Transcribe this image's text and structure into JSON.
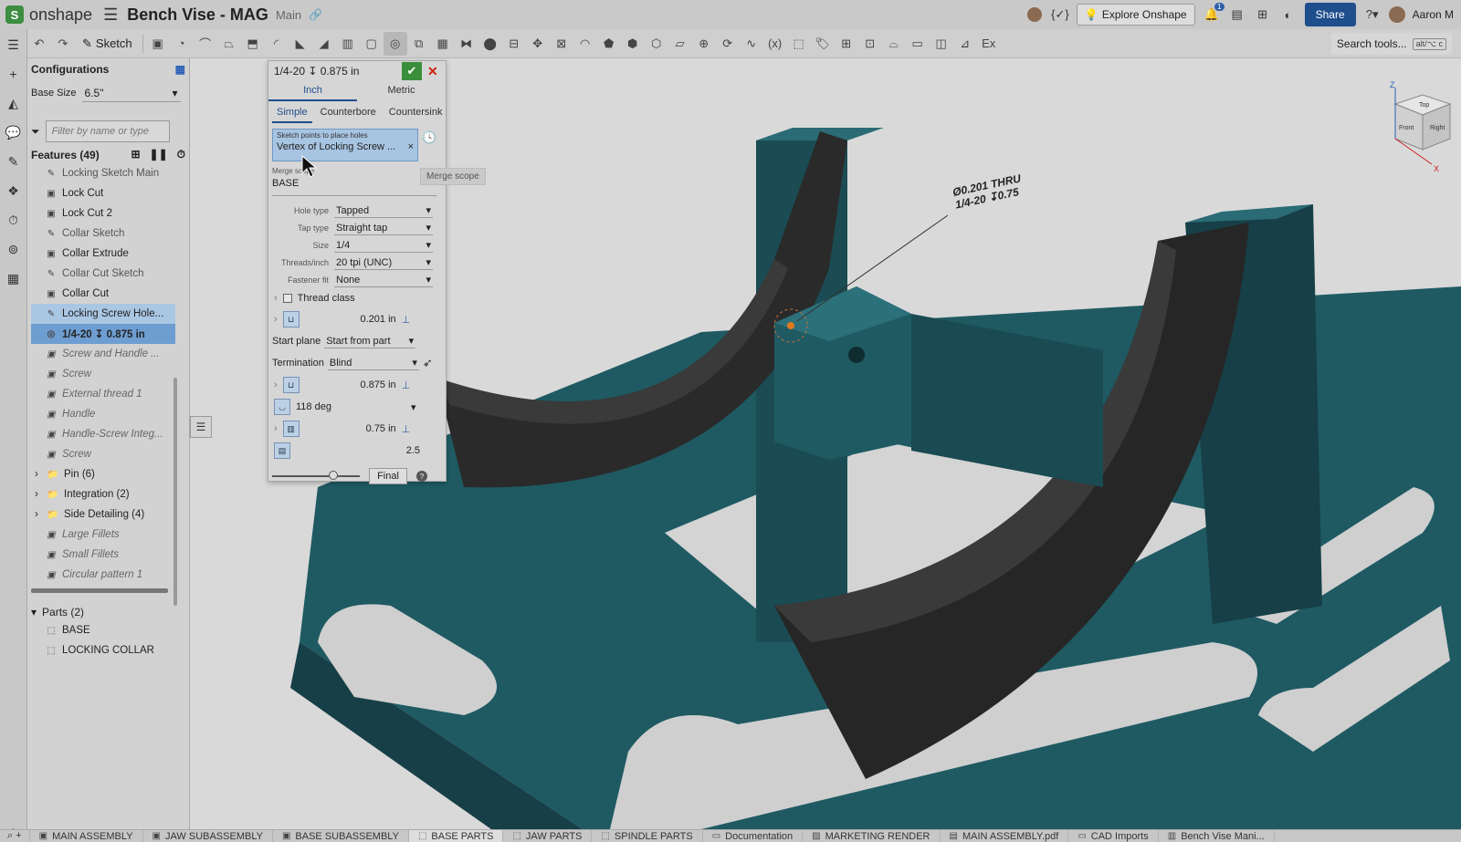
{
  "app": {
    "logo_text": "onshape",
    "doc_title": "Bench Vise - MAG",
    "branch": "Main"
  },
  "topbar": {
    "explore_label": "Explore Onshape",
    "notifications_count": "1",
    "share_label": "Share",
    "user_name": "Aaron M"
  },
  "toolbar": {
    "sketch_label": "Sketch",
    "search_label": "Search tools...",
    "search_shortcut": "alt/⌥ c"
  },
  "configurations": {
    "title": "Configurations",
    "base_size_label": "Base Size",
    "base_size_value": "6.5\"",
    "filter_placeholder": "Filter by name or type"
  },
  "features": {
    "header": "Features (49)",
    "items": [
      {
        "label": "Locking Sketch Main",
        "kind": "sketch"
      },
      {
        "label": "Lock Cut",
        "kind": "feature"
      },
      {
        "label": "Lock Cut 2",
        "kind": "feature"
      },
      {
        "label": "Collar Sketch",
        "kind": "sketch"
      },
      {
        "label": "Collar Extrude",
        "kind": "feature"
      },
      {
        "label": "Collar Cut Sketch",
        "kind": "sketch"
      },
      {
        "label": "Collar Cut",
        "kind": "feature"
      },
      {
        "label": "Locking Screw Hole...",
        "kind": "selected"
      },
      {
        "label": "1/4-20 ↧ 0.875 in",
        "kind": "current"
      },
      {
        "label": "Screw and Handle ...",
        "kind": "dim"
      },
      {
        "label": "Screw",
        "kind": "dim"
      },
      {
        "label": "External thread 1",
        "kind": "dim"
      },
      {
        "label": "Handle",
        "kind": "dim"
      },
      {
        "label": "Handle-Screw Integ...",
        "kind": "dim"
      },
      {
        "label": "Screw",
        "kind": "dim"
      },
      {
        "label": "Pin (6)",
        "kind": "folder"
      },
      {
        "label": "Integration (2)",
        "kind": "folder"
      },
      {
        "label": "Side Detailing (4)",
        "kind": "folder"
      },
      {
        "label": "Large Fillets",
        "kind": "dim"
      },
      {
        "label": "Small Fillets",
        "kind": "dim"
      },
      {
        "label": "Circular pattern 1",
        "kind": "dim"
      }
    ],
    "parts_header": "Parts (2)",
    "parts": [
      "BASE",
      "LOCKING COLLAR"
    ]
  },
  "hole_dialog": {
    "title": "1/4-20 ↧ 0.875 in",
    "units_tabs": [
      "Inch",
      "Metric"
    ],
    "style_tabs": [
      "Simple",
      "Counterbore",
      "Countersink"
    ],
    "sketch_points_label": "Sketch points to place holes",
    "sketch_points_value": "Vertex of Locking Screw ...",
    "merge_scope_label": "Merge scope",
    "merge_scope_value": "BASE",
    "merge_scope_tooltip": "Merge scope",
    "hole_type_label": "Hole type",
    "hole_type": "Tapped",
    "tap_type_label": "Tap type",
    "tap_type": "Straight tap",
    "size_label": "Size",
    "size": "1/4",
    "threads_label": "Threads/inch",
    "threads": "20 tpi (UNC)",
    "fastener_fit_label": "Fastener fit",
    "fastener_fit": "None",
    "thread_class_label": "Thread class",
    "tap_drill_diameter": "0.201 in",
    "start_plane_label": "Start plane",
    "start_plane": "Start from part",
    "termination_label": "Termination",
    "termination": "Blind",
    "depth": "0.875 in",
    "tip_angle": "118 deg",
    "tapped_depth": "0.75 in",
    "tap_clearance": "2.5",
    "final_label": "Final"
  },
  "viewport": {
    "annotation_line1": "Ø0.201 THRU",
    "annotation_line2": "1/4-20 ↧0.75",
    "viewcube_front": "Front",
    "viewcube_right": "Right",
    "viewcube_top": "Top",
    "axis_z": "Z",
    "axis_x": "X"
  },
  "bottom_tabs": [
    {
      "label": "MAIN ASSEMBLY",
      "icon": "assembly-icon"
    },
    {
      "label": "JAW SUBASSEMBLY",
      "icon": "assembly-icon"
    },
    {
      "label": "BASE SUBASSEMBLY",
      "icon": "assembly-icon"
    },
    {
      "label": "BASE PARTS",
      "icon": "partstudio-icon",
      "active": true
    },
    {
      "label": "JAW PARTS",
      "icon": "partstudio-icon"
    },
    {
      "label": "SPINDLE PARTS",
      "icon": "partstudio-icon"
    },
    {
      "label": "Documentation",
      "icon": "folder-icon"
    },
    {
      "label": "MARKETING RENDER",
      "icon": "image-icon"
    },
    {
      "label": "MAIN ASSEMBLY.pdf",
      "icon": "pdf-icon"
    },
    {
      "label": "CAD Imports",
      "icon": "folder-icon"
    },
    {
      "label": "Bench Vise Mani...",
      "icon": "doc-icon"
    }
  ],
  "colors": {
    "model_teal": "#1f5a63",
    "jaw_dark": "#262626",
    "selection_blue": "#6e9dd1",
    "share_blue": "#1f4e8c",
    "ok_green": "#3b8e3b"
  }
}
